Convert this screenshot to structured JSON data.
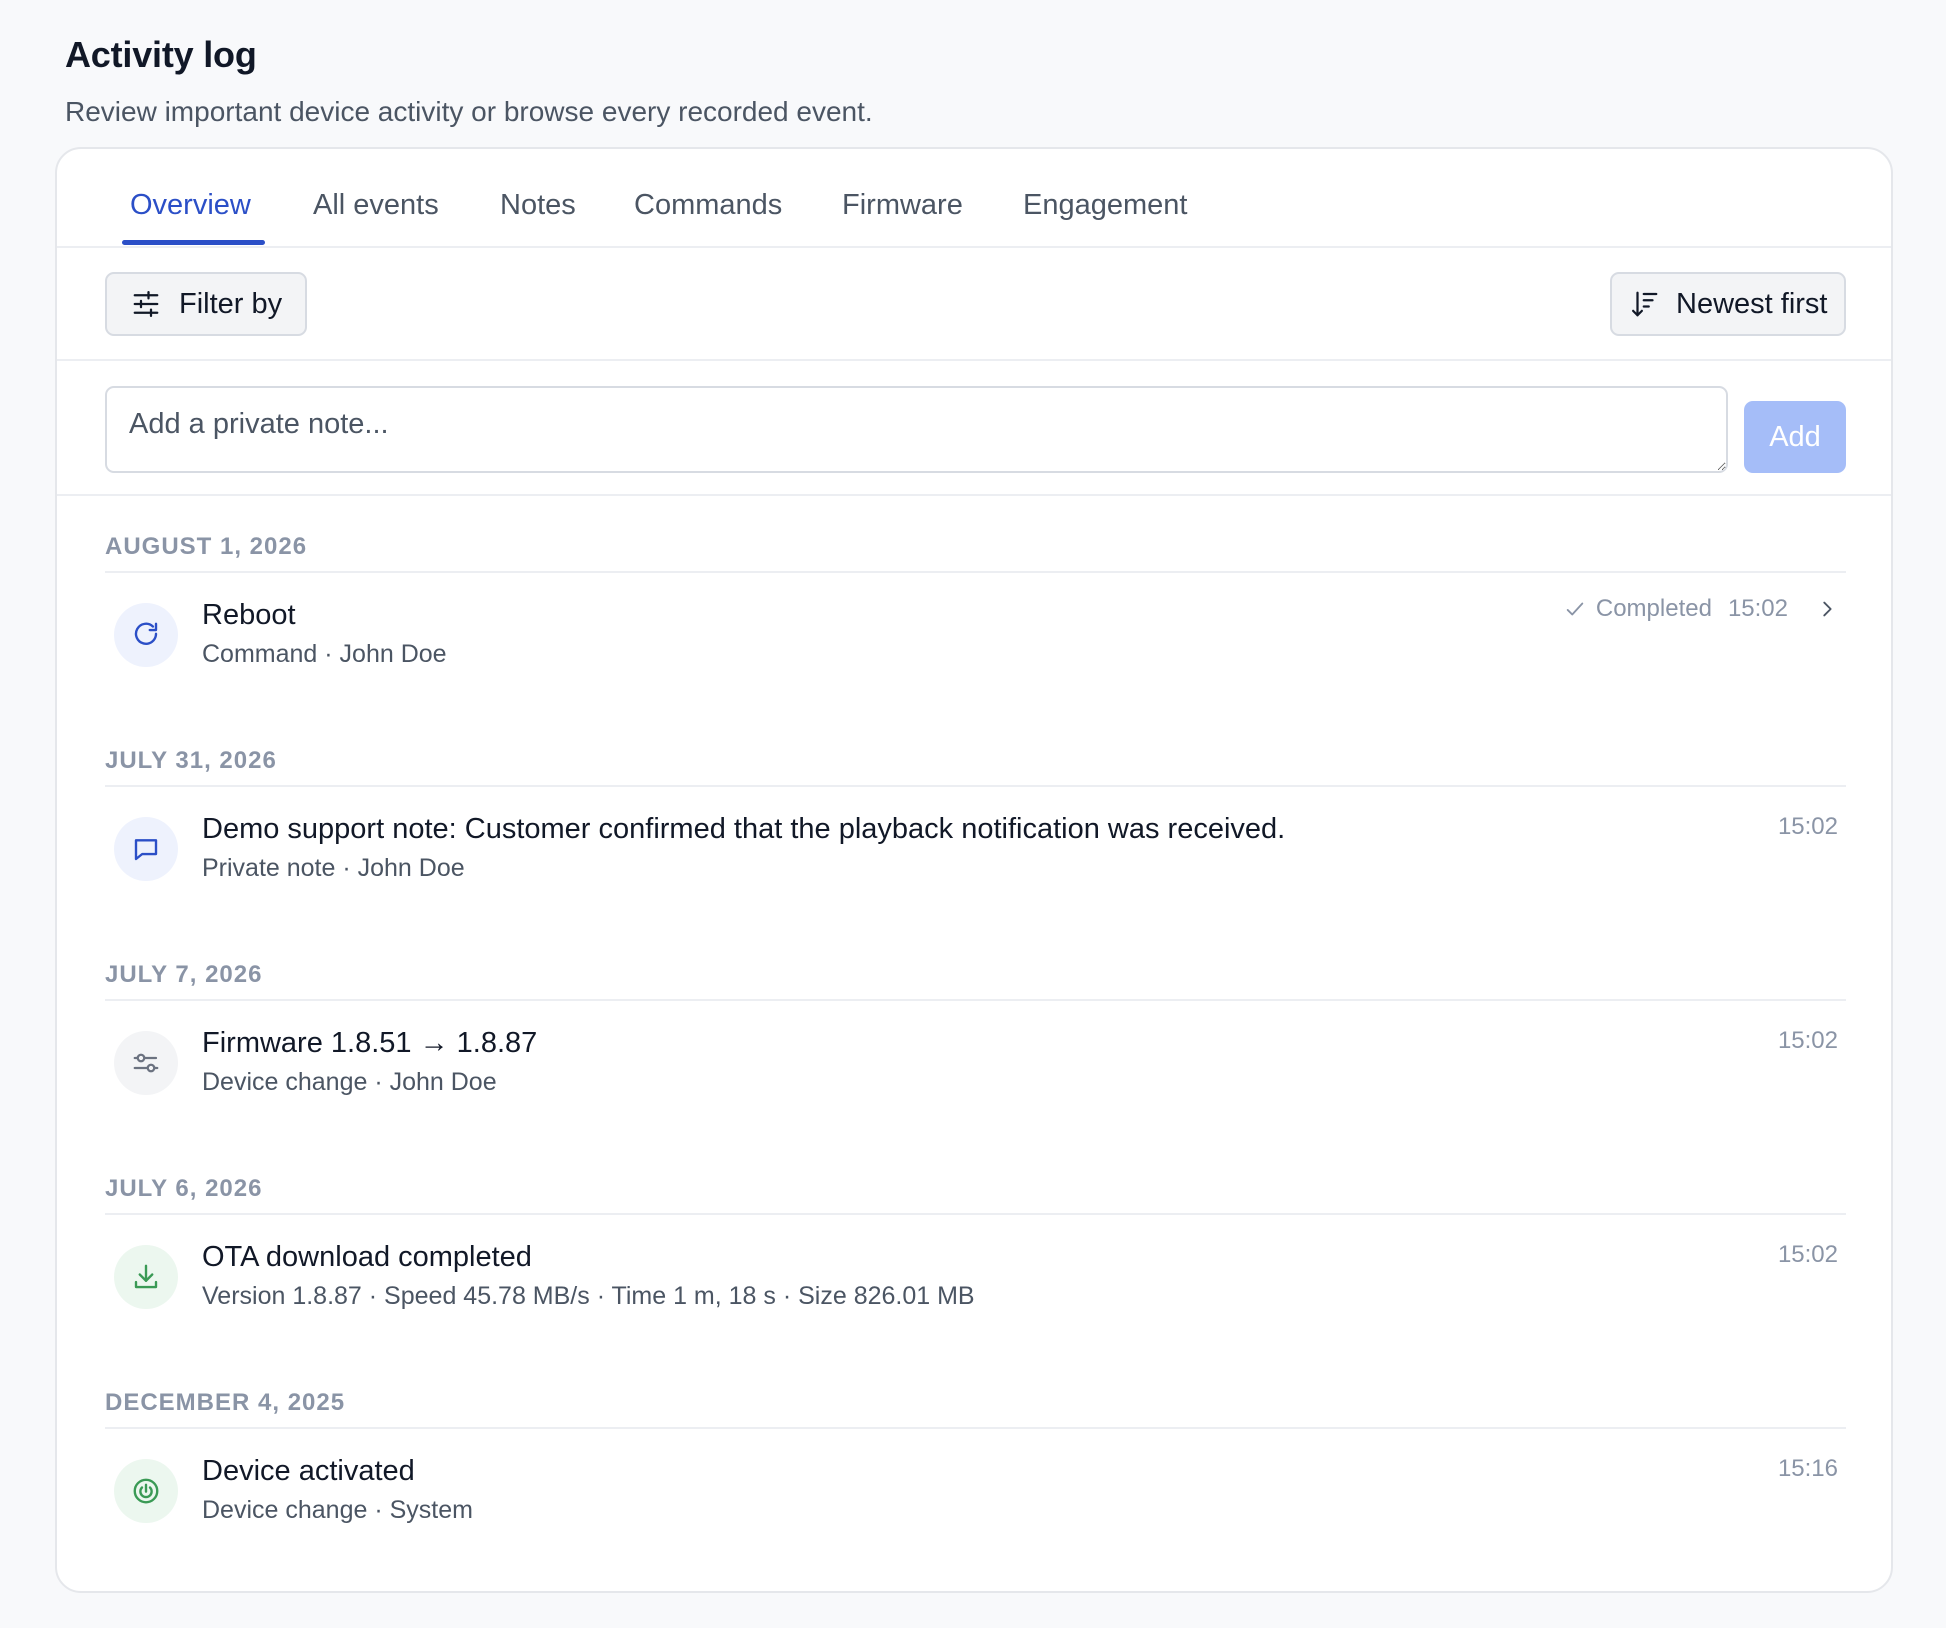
{
  "page": {
    "title": "Activity log",
    "subtitle": "Review important device activity or browse every recorded event."
  },
  "tabs": [
    {
      "label": "Overview",
      "active": true
    },
    {
      "label": "All events",
      "active": false
    },
    {
      "label": "Notes",
      "active": false
    },
    {
      "label": "Commands",
      "active": false
    },
    {
      "label": "Firmware",
      "active": false
    },
    {
      "label": "Engagement",
      "active": false
    }
  ],
  "toolbar": {
    "filter_label": "Filter by",
    "filter_icon": "sliders-icon",
    "sort_label": "Newest first",
    "sort_icon": "sort-descending-icon"
  },
  "note": {
    "placeholder": "Add a private note...",
    "value": "",
    "add_label": "Add"
  },
  "groups": [
    {
      "date": "AUGUST 1, 2026",
      "events": [
        {
          "title": "Reboot",
          "subtitle": "Command · John Doe",
          "icon": "refresh-icon",
          "icon_tone": "blue",
          "status": "Completed",
          "time": "15:02",
          "has_details": true
        }
      ]
    },
    {
      "date": "JULY 31, 2026",
      "events": [
        {
          "title": "Demo support note: Customer confirmed that the playback notification was received.",
          "subtitle": "Private note · John Doe",
          "icon": "chat-bubble-icon",
          "icon_tone": "blue",
          "time": "15:02"
        }
      ]
    },
    {
      "date": "JULY 7, 2026",
      "events": [
        {
          "title": "Firmware 1.8.51 → 1.8.87",
          "subtitle": "Device change · John Doe",
          "icon": "settings-toggle-icon",
          "icon_tone": "gray",
          "time": "15:02"
        }
      ]
    },
    {
      "date": "JULY 6, 2026",
      "events": [
        {
          "title": "OTA download completed",
          "subtitle": "Version 1.8.87 · Speed 45.78 MB/s · Time 1 m, 18 s · Size 826.01 MB",
          "icon": "download-icon",
          "icon_tone": "green",
          "time": "15:02"
        }
      ]
    },
    {
      "date": "DECEMBER 4, 2025",
      "events": [
        {
          "title": "Device activated",
          "subtitle": "Device change · System",
          "icon": "power-icon",
          "icon_tone": "green",
          "time": "15:16"
        }
      ]
    }
  ],
  "colors": {
    "accent": "#2b4fc7",
    "add_button_disabled": "#a5bdf8",
    "muted": "#8a94a6",
    "success": "#3a9a55"
  }
}
